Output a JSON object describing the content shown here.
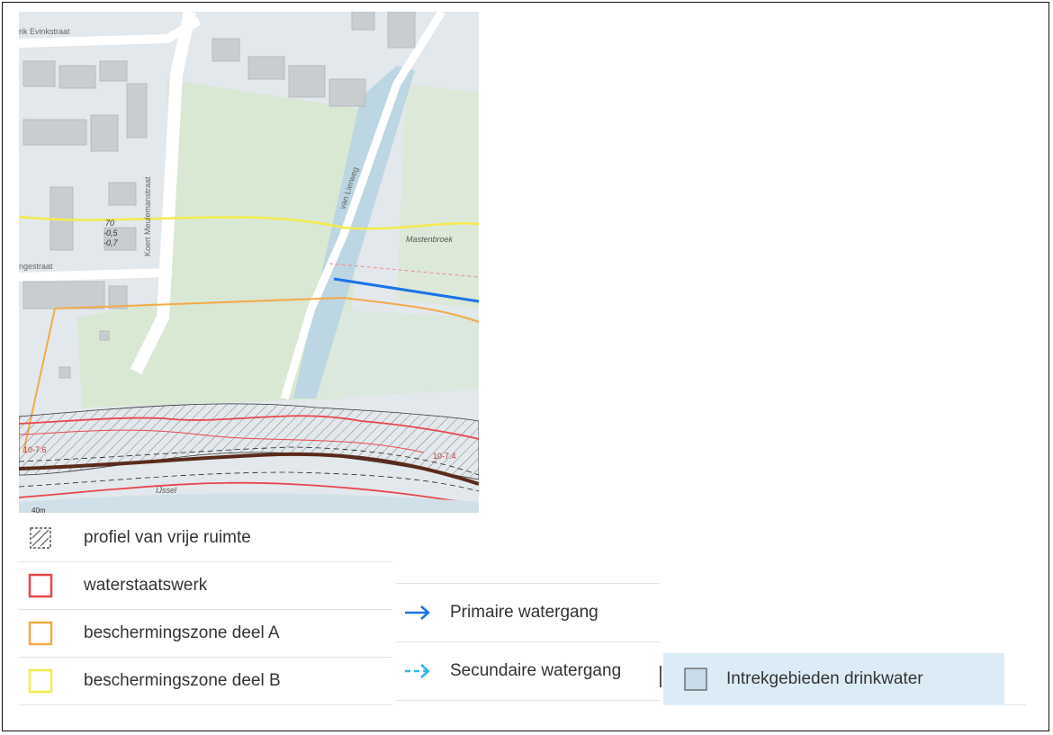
{
  "map": {
    "street_labels": {
      "evinkstraat": "rik Evinkstraat",
      "meulemanstraat": "Koert Meulemanstraat",
      "ngestraat": "ngestraat",
      "lierweg": "van Lierweg",
      "ijssel": "IJssel"
    },
    "place_labels": {
      "mastenbroek": "Mastenbroek"
    },
    "elevation_labels": {
      "a": "70",
      "b": "-0,5",
      "c": "-0,7"
    },
    "dike_labels": {
      "left": "10-7.6",
      "right": "10-7.4"
    },
    "scale_text": "40m",
    "colors": {
      "water": "#bcd6e3",
      "grass": "#dbe9d3",
      "road": "#ffffff",
      "building": "#c9cdd0",
      "background": "#dfe6ea"
    }
  },
  "legend": {
    "left": [
      {
        "label": "profiel van vrije ruimte",
        "icon": "hatched-square-icon",
        "color": "#555555"
      },
      {
        "label": "waterstaatswerk",
        "icon": "red-square-icon",
        "color": "#e8474c"
      },
      {
        "label": "beschermingszone deel A",
        "icon": "orange-square-icon",
        "color": "#f3a948"
      },
      {
        "label": "beschermingszone deel B",
        "icon": "yellow-square-icon",
        "color": "#f4ea4c"
      }
    ],
    "middle": [
      {
        "label": "Primaire watergang",
        "icon": "arrow-right-solid-icon",
        "color": "#1a73e8"
      },
      {
        "label": "Secundaire watergang",
        "icon": "arrow-right-dashed-icon",
        "color": "#32b6ea"
      }
    ],
    "right": {
      "label": "Intrekgebieden drinkwater",
      "icon": "blue-square-icon",
      "color": "#c9dbe8"
    }
  }
}
